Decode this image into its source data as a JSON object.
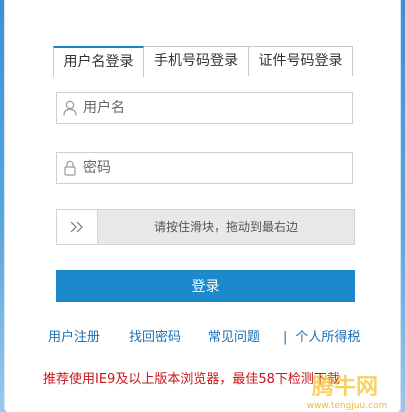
{
  "tabs": [
    {
      "label": "用户名登录"
    },
    {
      "label": "手机号码登录"
    },
    {
      "label": "证件号码登录"
    }
  ],
  "username": {
    "placeholder": "用户名",
    "icon": "user-icon"
  },
  "password": {
    "placeholder": "密码",
    "icon": "lock-icon"
  },
  "slider": {
    "hint": "请按住滑块，拖动到最右边",
    "icon": "double-chevron-right-icon"
  },
  "login_button": "登录",
  "links": {
    "register": "用户注册",
    "recover": "找回密码",
    "faq": "常见问题",
    "separator": "|",
    "personal_tax": "个人所得税"
  },
  "notice": "推荐使用IE9及以上版本浏览器，最佳58下检测下载",
  "watermark": {
    "main": "腾牛网",
    "sub": "www.tengjuu.com"
  },
  "colors": {
    "accent": "#1c89cc",
    "link": "#1a6fb5",
    "notice": "#c8161d"
  }
}
